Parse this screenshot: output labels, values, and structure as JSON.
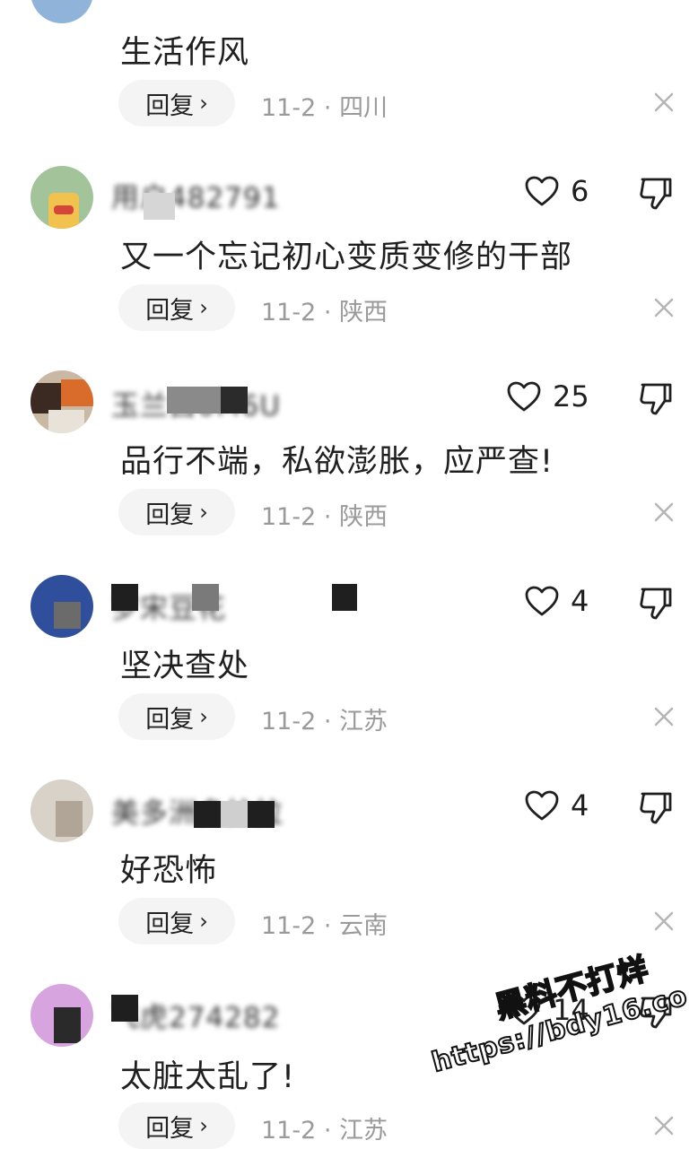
{
  "comments": [
    {
      "text": "生活作风",
      "reply_label": "回复",
      "date": "11-2",
      "location": "四川"
    },
    {
      "username": "用户482791",
      "likes": "6",
      "text": "又一个忘记初心变质变修的干部",
      "reply_label": "回复",
      "date": "11-2",
      "location": "陕西"
    },
    {
      "username": "玉兰白0M6U",
      "likes": "25",
      "text": "品行不端，私欲澎胀，应严查!",
      "reply_label": "回复",
      "date": "11-2",
      "location": "陕西"
    },
    {
      "username": "罗宋豆花",
      "likes": "4",
      "text": "坚决查处",
      "reply_label": "回复",
      "date": "11-2",
      "location": "江苏"
    },
    {
      "username": "美多洲多拉拉",
      "likes": "4",
      "text": "好恐怖",
      "reply_label": "回复",
      "date": "11-2",
      "location": "云南"
    },
    {
      "username": "飞虎274282",
      "likes": "14",
      "text": "太脏太乱了!",
      "reply_label": "回复",
      "date": "11-2",
      "location": "江苏"
    }
  ],
  "meta_separator": "·",
  "reply_chevron": "›",
  "watermark": {
    "line1": "黑料不打烊",
    "line2": "https://bdy16.co"
  },
  "icons": {
    "like": "heart-outline-icon",
    "dislike": "thumbs-down-icon",
    "close": "close-icon"
  }
}
